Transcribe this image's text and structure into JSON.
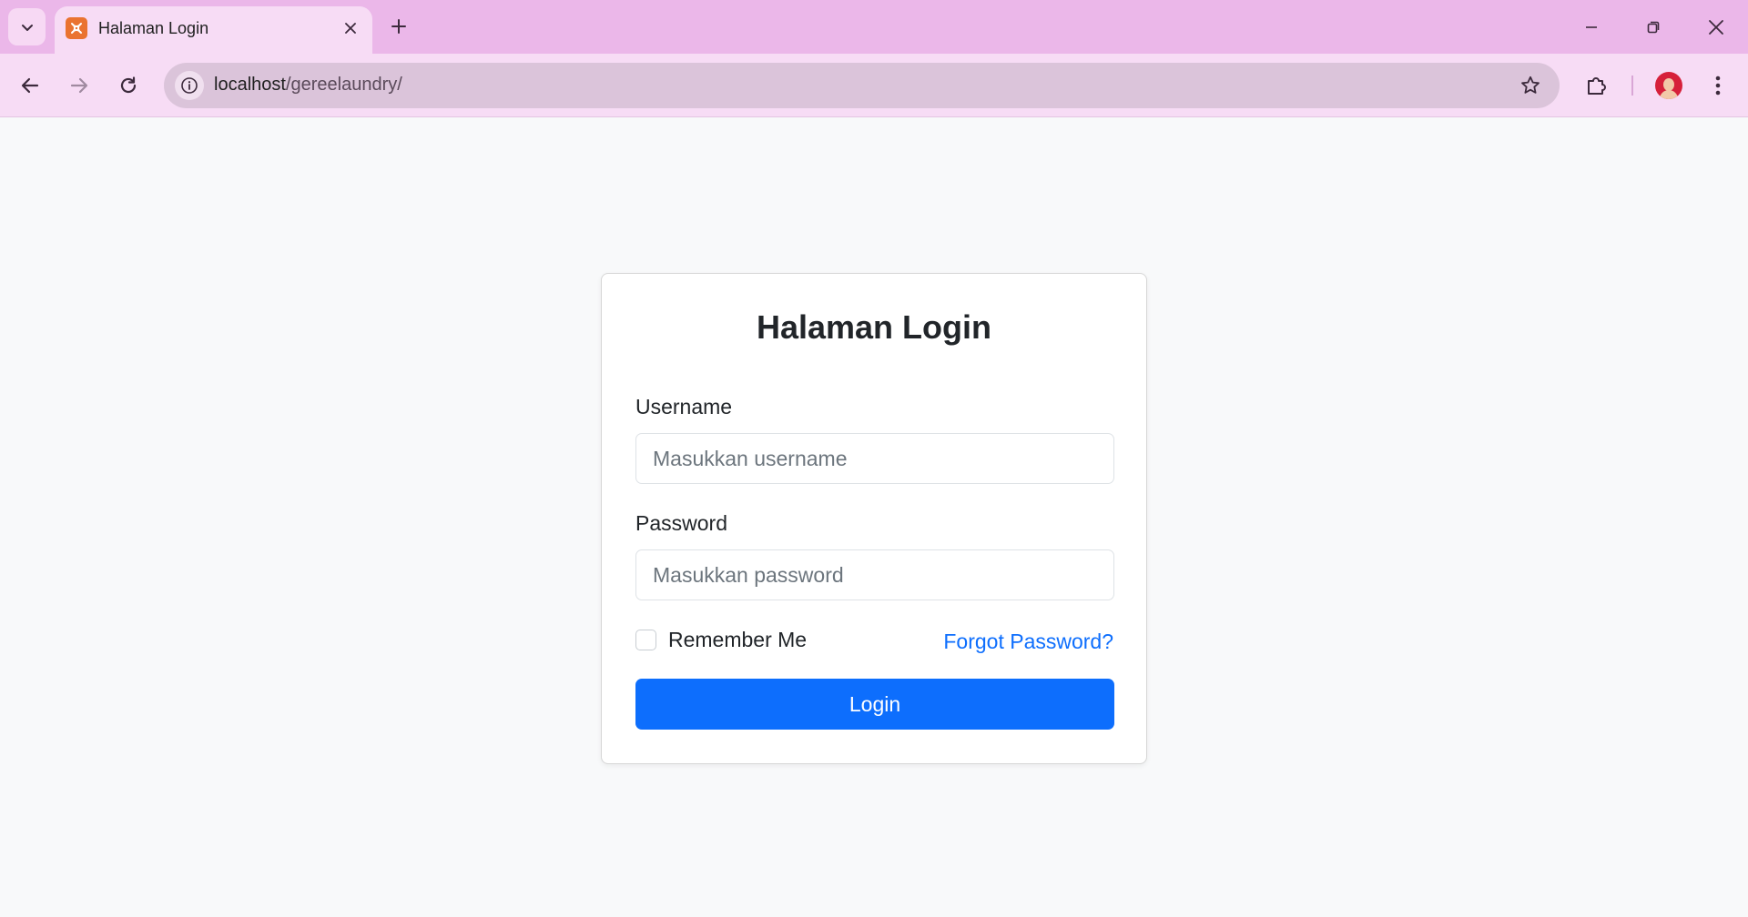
{
  "browser": {
    "tab_title": "Halaman Login",
    "url_host": "localhost",
    "url_path": "/gereelaundry/"
  },
  "login": {
    "title": "Halaman Login",
    "username_label": "Username",
    "username_placeholder": "Masukkan username",
    "password_label": "Password",
    "password_placeholder": "Masukkan password",
    "remember_label": "Remember Me",
    "forgot_label": "Forgot Password?",
    "submit_label": "Login"
  },
  "colors": {
    "tabbar": "#ebb7e9",
    "toolbar": "#f7dcf5",
    "primary": "#0d6efd",
    "page_bg": "#f8f9fa"
  },
  "icons": [
    "tab-search-icon",
    "xampp-favicon-icon",
    "close-icon",
    "plus-icon",
    "minimize-icon",
    "restore-icon",
    "window-close-icon",
    "back-arrow-icon",
    "forward-arrow-icon",
    "reload-icon",
    "info-icon",
    "star-icon",
    "extensions-icon",
    "more-vertical-icon"
  ]
}
